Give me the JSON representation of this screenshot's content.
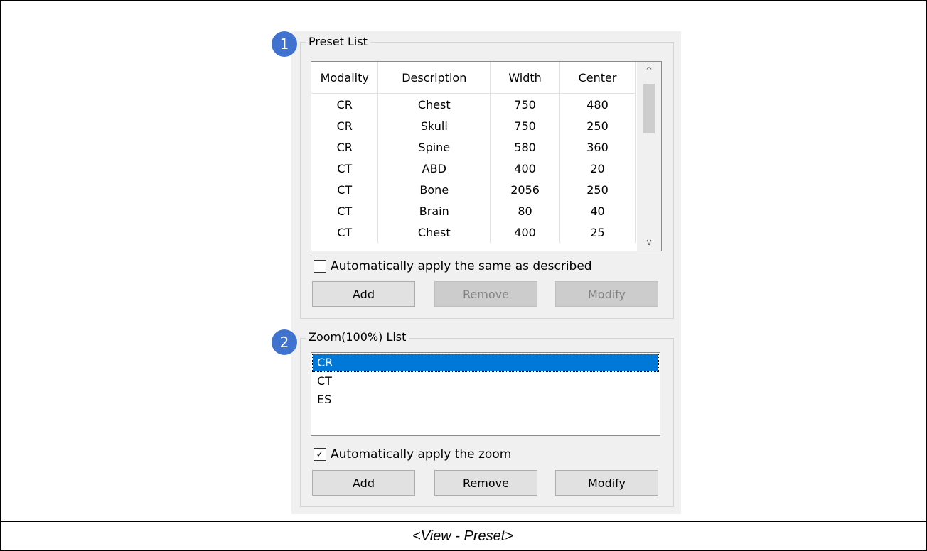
{
  "preset": {
    "badge": "1",
    "title": "Preset List",
    "columns": [
      "Modality",
      "Description",
      "Width",
      "Center"
    ],
    "rows": [
      [
        "CR",
        "Chest",
        "750",
        "480"
      ],
      [
        "CR",
        "Skull",
        "750",
        "250"
      ],
      [
        "CR",
        "Spine",
        "580",
        "360"
      ],
      [
        "CT",
        "ABD",
        "400",
        "20"
      ],
      [
        "CT",
        "Bone",
        "2056",
        "250"
      ],
      [
        "CT",
        "Brain",
        "80",
        "40"
      ],
      [
        "CT",
        "Chest",
        "400",
        "25"
      ]
    ],
    "scroll_up": "^",
    "scroll_down": "v",
    "auto_apply_label": "Automatically apply the same as described",
    "auto_apply_checked": false,
    "add_label": "Add",
    "remove_label": "Remove",
    "modify_label": "Modify"
  },
  "zoom": {
    "badge": "2",
    "title": "Zoom(100%) List",
    "items": [
      "CR",
      "CT",
      "ES"
    ],
    "selected": "CR",
    "auto_apply_label": "Automatically apply the zoom",
    "auto_apply_checked": true,
    "check_mark": "✓",
    "add_label": "Add",
    "remove_label": "Remove",
    "modify_label": "Modify"
  },
  "caption": "<View - Preset>",
  "colors": {
    "badge": "#3f73cf",
    "selection": "#0078d7",
    "panel": "#f0f0f0"
  }
}
